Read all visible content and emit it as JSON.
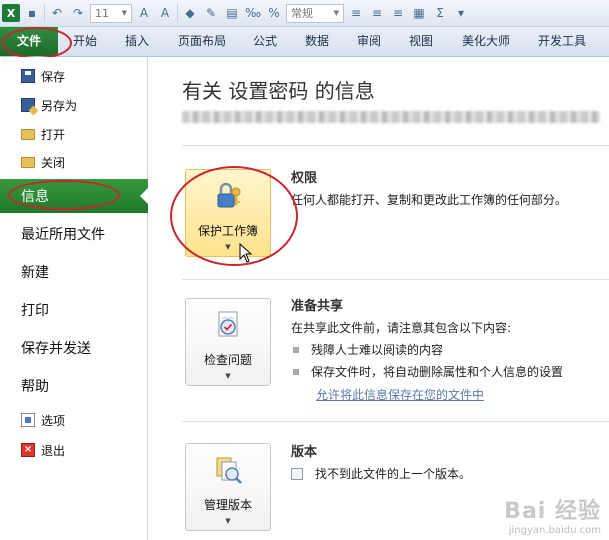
{
  "window": {
    "qat_font_size": "11",
    "qat_number_format": "常规"
  },
  "ribbon": {
    "tabs": [
      "文件",
      "开始",
      "插入",
      "页面布局",
      "公式",
      "数据",
      "审阅",
      "视图",
      "美化大师",
      "开发工具"
    ]
  },
  "nav": {
    "save": "保存",
    "save_as": "另存为",
    "open": "打开",
    "close": "关闭",
    "info": "信息",
    "recent": "最近所用文件",
    "new": "新建",
    "print": "打印",
    "save_send": "保存并发送",
    "help": "帮助",
    "options": "选项",
    "exit": "退出"
  },
  "main": {
    "title": "有关 设置密码 的信息",
    "permissions": {
      "button_label": "保护工作簿",
      "heading": "权限",
      "text": "任何人都能打开、复制和更改此工作簿的任何部分。"
    },
    "prepare": {
      "button_label": "检查问题",
      "heading": "准备共享",
      "text": "在共享此文件前，请注意其包含以下内容:",
      "bullets": [
        "残障人士难以阅读的内容",
        "保存文件时，将自动删除属性和个人信息的设置"
      ],
      "link": "允许将此信息保存在您的文件中"
    },
    "versions": {
      "button_label": "管理版本",
      "heading": "版本",
      "text": "找不到此文件的上一个版本。"
    }
  },
  "watermark": {
    "brand": "Bai 经验",
    "url": "jingyan.baidu.com"
  },
  "colors": {
    "file_tab": "#1d6a2b",
    "active_nav": "#37983f",
    "highlight_ellipse": "#c8262c"
  }
}
